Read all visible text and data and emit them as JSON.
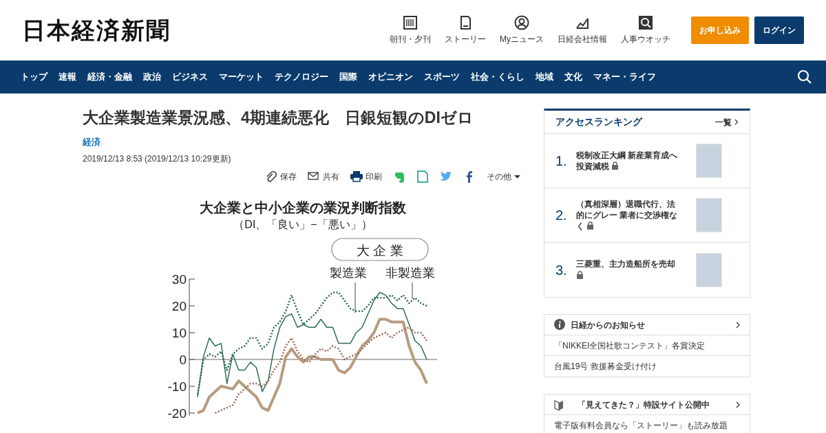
{
  "header": {
    "logo": "日本経済新聞",
    "links": [
      {
        "label": "朝刊・夕刊",
        "kind": "paper"
      },
      {
        "label": "ストーリー",
        "kind": "book"
      },
      {
        "label": "Myニュース",
        "kind": "user"
      },
      {
        "label": "日経会社情報",
        "kind": "chart"
      },
      {
        "label": "人事ウオッチ",
        "kind": "search"
      }
    ],
    "buttons": [
      {
        "label": "お申し込み",
        "kind": "primary"
      },
      {
        "label": "ログイン",
        "kind": "dark"
      }
    ]
  },
  "nav": {
    "items": [
      "トップ",
      "速報",
      "経済・金融",
      "政治",
      "ビジネス",
      "マーケット",
      "テクノロジー",
      "国際",
      "オピニオン",
      "スポーツ",
      "社会・くらし",
      "地域",
      "文化",
      "マネー・ライフ"
    ]
  },
  "article": {
    "title": "大企業製造業景況感、4期連続悪化　日銀短観のDIゼロ",
    "category": "経済",
    "date": "2019/12/13 8:53 (2019/12/13 10:29更新)",
    "share": [
      {
        "kind": "save",
        "label": "保存"
      },
      {
        "kind": "mail",
        "label": "共有"
      },
      {
        "kind": "print",
        "label": "印刷"
      },
      {
        "kind": "evernote"
      },
      {
        "kind": "memo"
      },
      {
        "kind": "twitter"
      },
      {
        "kind": "facebook"
      },
      {
        "kind": "more",
        "label": "その他"
      }
    ],
    "figure": {
      "chart_data": {
        "type": "line",
        "title": "大企業と中小企業の業況判断指数",
        "ylabel": "（DI、「良い」−「悪い」）",
        "yticks": [
          30,
          20,
          10,
          0,
          -10,
          -20
        ],
        "ylim": [
          -21,
          30
        ],
        "series": [
          {
            "color": "#2e6a5c",
            "line_style": "solid",
            "values": [
              -14,
              1,
              8,
              5,
              6,
              -9,
              2,
              -4,
              -4,
              -1,
              -3,
              -12,
              -8,
              4,
              12,
              16,
              17,
              12,
              13,
              12,
              12,
              15,
              12,
              12,
              6,
              6,
              6,
              10,
              12,
              17,
              22,
              25,
              24,
              21,
              19,
              19,
              13,
              7,
              5,
              0
            ]
          },
          {
            "color": "#2e6a5c",
            "line_style": "dotted",
            "values": [
              -13,
              0,
              2,
              1,
              3,
              -4,
              2,
              4,
              5,
              8,
              8,
              4,
              6,
              12,
              14,
              18,
              24,
              18,
              13,
              15,
              17,
              20,
              23,
              25,
              25,
              22,
              19,
              18,
              18,
              20,
              23,
              23,
              23,
              24,
              22,
              24,
              21,
              23,
              21,
              20
            ]
          },
          {
            "color": "#b89a7e",
            "line_style": "solid",
            "values": [
              -20,
              -19,
              -14,
              -12,
              -10,
              null,
              -11,
              -8,
              -10,
              -12,
              -14,
              -18,
              -19,
              -14,
              -9,
              1,
              4,
              1,
              -1,
              1,
              1,
              0,
              0,
              0,
              -4,
              -5,
              -3,
              1,
              5,
              7,
              10,
              15,
              15,
              14,
              14,
              14,
              5,
              -1,
              -4,
              -9
            ]
          },
          {
            "color": "#9a6a56",
            "line_style": "dotted",
            "values": [
              null,
              null,
              null,
              -20,
              null,
              null,
              -17,
              -13,
              -11,
              -9,
              -9,
              -10,
              -8,
              -4,
              -1,
              5,
              8,
              3,
              0,
              -1,
              2,
              4,
              3,
              5,
              4,
              0,
              1,
              2,
              4,
              6,
              8,
              9,
              10,
              8,
              10,
              11,
              12,
              10,
              10,
              7
            ]
          }
        ],
        "annotations": [
          "大 企 業",
          "製造業",
          "非製造業"
        ]
      }
    }
  },
  "sidebar": {
    "ranking": {
      "title": "アクセスランキング",
      "more": "一覧",
      "items": [
        {
          "rank": "1.",
          "text": "税制改正大綱 新産業育成へ投資減税",
          "locked": true
        },
        {
          "rank": "2.",
          "text": "（真相深層）退職代行、法的にグレー 業者に交渉権なく",
          "locked": true
        },
        {
          "rank": "3.",
          "text": "三菱重、主力造船所を売却",
          "locked": true
        }
      ]
    },
    "notices": [
      {
        "kind": "info",
        "title": "日経からのお知らせ",
        "links": [
          "「NIKKEI全国社歌コンテスト」各賞決定",
          "台風19号 救援募金受け付け"
        ]
      },
      {
        "kind": "beginner",
        "title": "「見えてきた？」特設サイト公開中",
        "links": [
          "電子版有料会員なら「ストーリー」も読み放題"
        ]
      }
    ]
  }
}
